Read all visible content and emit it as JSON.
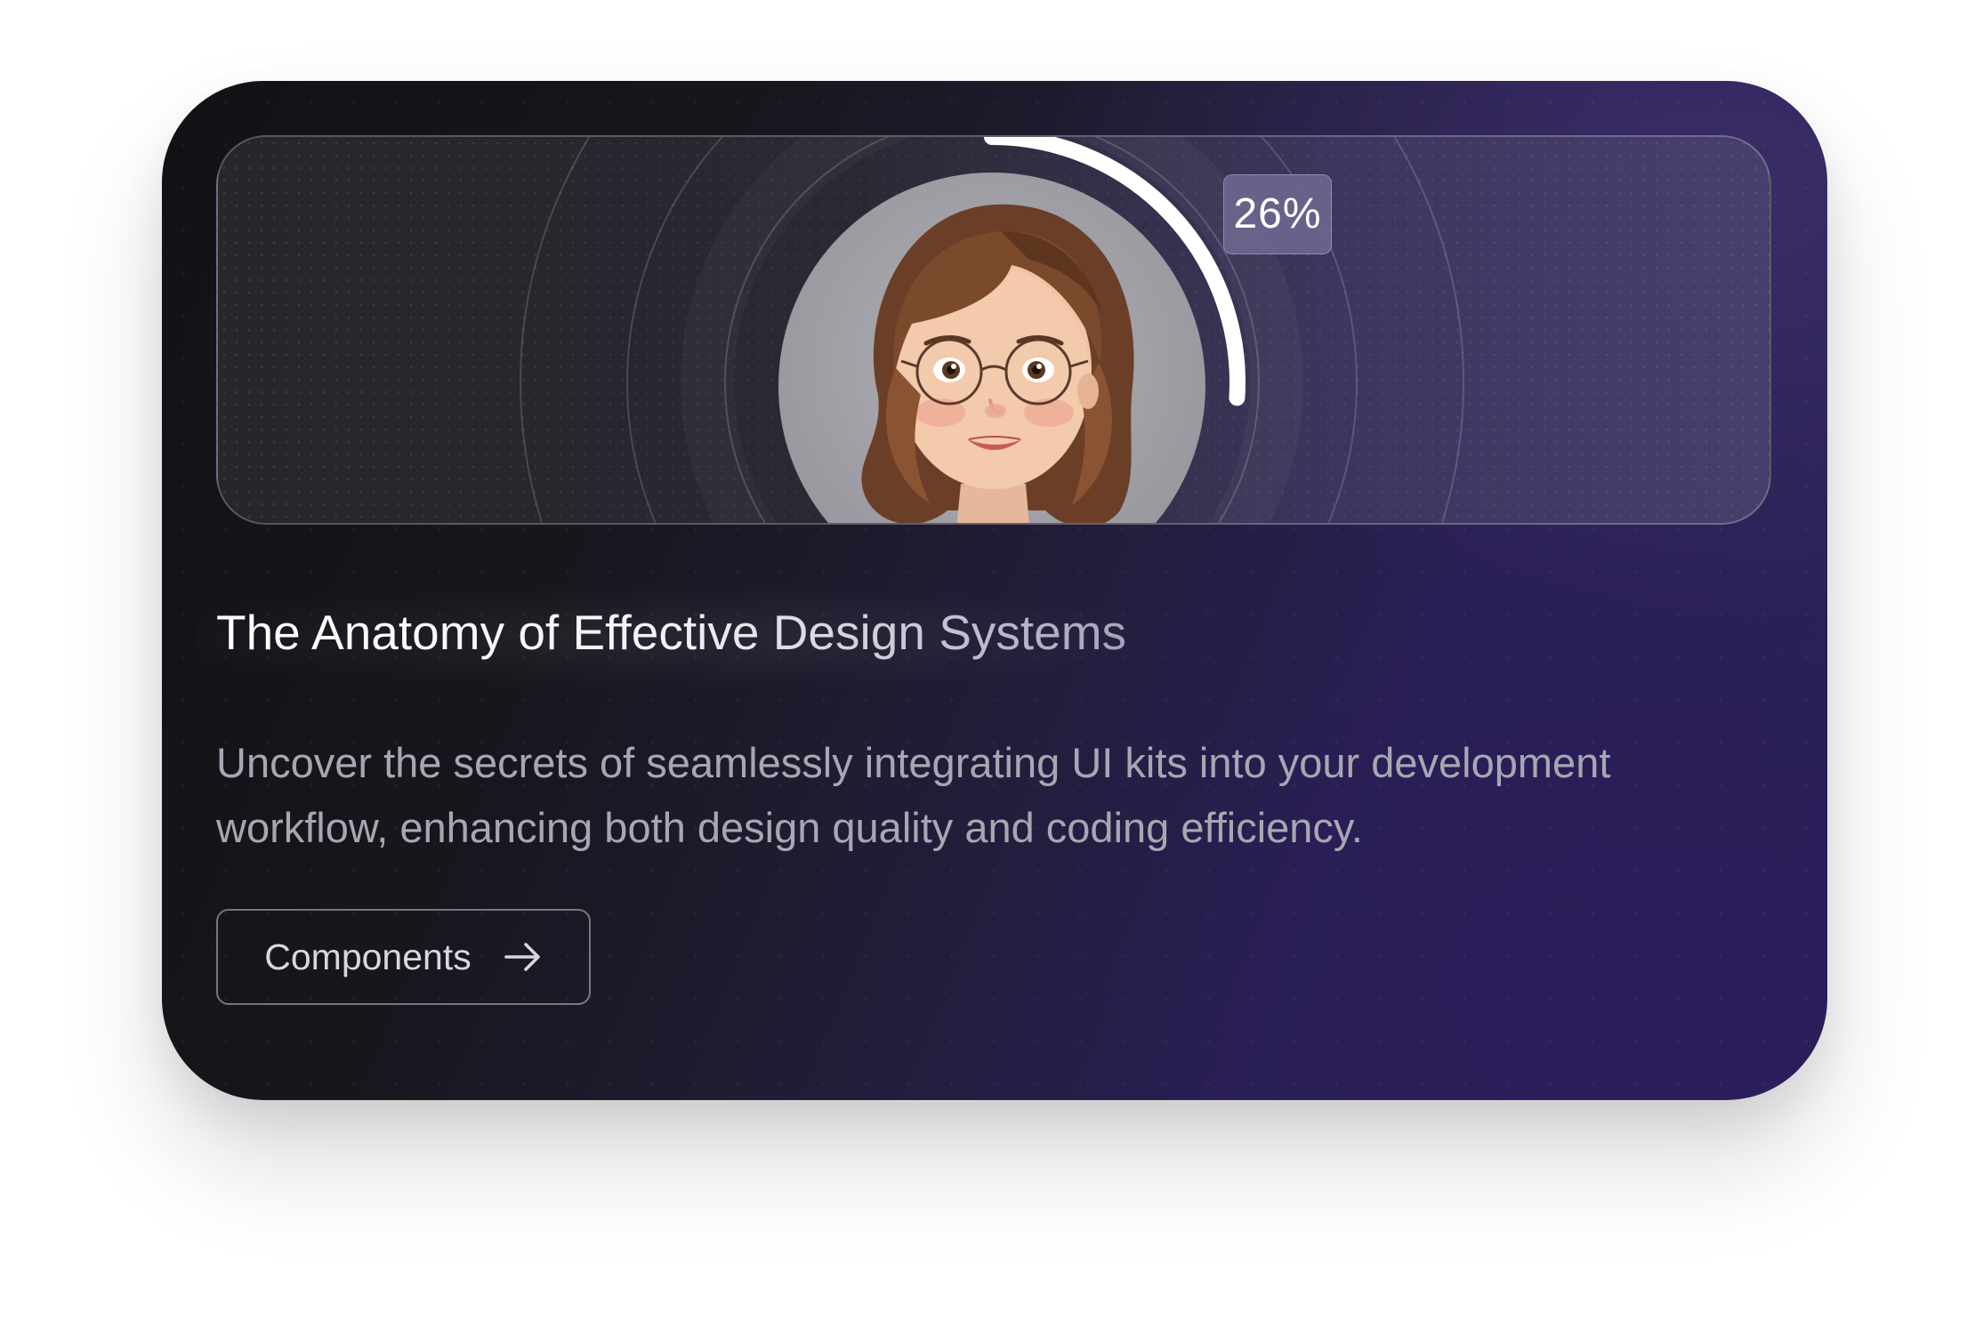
{
  "card": {
    "progress": {
      "percent_label": "26%",
      "value": 0.26
    },
    "avatar": {
      "icon": "avatar-illustration"
    },
    "title": "The Anatomy of Effective Design Systems",
    "description": "Uncover the secrets of seamlessly integrating UI kits into your development workflow, enhancing both design quality and coding efficiency.",
    "cta": {
      "label": "Components",
      "icon": "arrow-right-icon"
    }
  },
  "colors": {
    "card_dark": "#121216",
    "card_purple": "#2b2058",
    "progress_arc": "#ffffff",
    "badge_bg": "#6c648c",
    "text_primary": "#ffffff",
    "text_secondary": "#a8a6b2"
  }
}
